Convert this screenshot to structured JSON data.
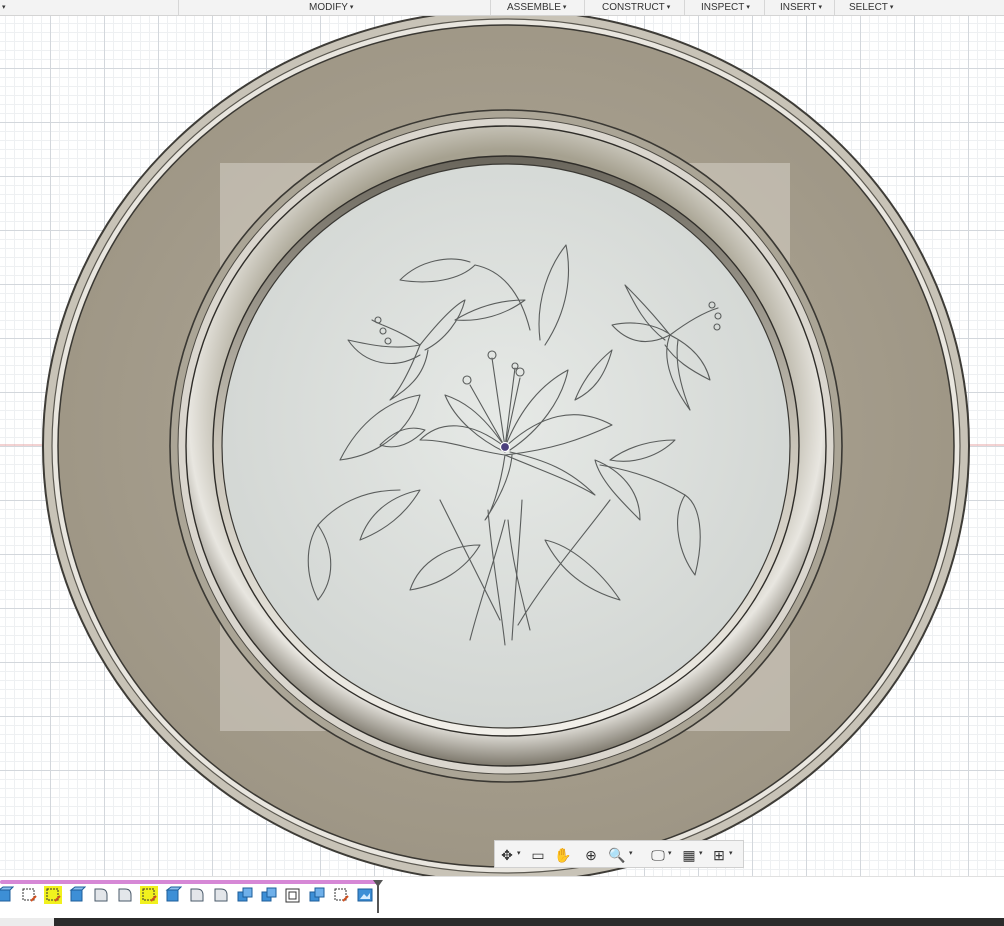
{
  "menubar": {
    "items": [
      {
        "label": "MODIFY"
      },
      {
        "label": "ASSEMBLE"
      },
      {
        "label": "CONSTRUCT"
      },
      {
        "label": "INSPECT"
      },
      {
        "label": "INSERT"
      },
      {
        "label": "SELECT"
      }
    ]
  },
  "navbar": {
    "tools": [
      {
        "icon": "orbit-icon",
        "glyph": "✥"
      },
      {
        "icon": "look-at-icon",
        "glyph": "▭"
      },
      {
        "icon": "pan-icon",
        "glyph": "✋"
      },
      {
        "icon": "zoom-icon",
        "glyph": "⊕"
      },
      {
        "icon": "fit-icon",
        "glyph": "🔍"
      },
      {
        "icon": "display-settings-icon",
        "glyph": "🖵"
      },
      {
        "icon": "grid-settings-icon",
        "glyph": "▦"
      },
      {
        "icon": "viewports-icon",
        "glyph": "⊞"
      }
    ]
  },
  "timeline": {
    "features": [
      {
        "icon": "extrude-feature-icon"
      },
      {
        "icon": "sketch-feature-icon"
      },
      {
        "icon": "sketch-feature-icon",
        "highlighted": true
      },
      {
        "icon": "extrude-feature-icon"
      },
      {
        "icon": "fillet-feature-icon"
      },
      {
        "icon": "fillet-feature-icon"
      },
      {
        "icon": "sketch-feature-icon",
        "highlighted": true
      },
      {
        "icon": "extrude-feature-icon"
      },
      {
        "icon": "fillet-feature-icon"
      },
      {
        "icon": "fillet-feature-icon"
      },
      {
        "icon": "combine-feature-icon"
      },
      {
        "icon": "combine-feature-icon"
      },
      {
        "icon": "shell-feature-icon"
      },
      {
        "icon": "combine-feature-icon"
      },
      {
        "icon": "sketch-feature-icon"
      },
      {
        "icon": "canvas-feature-icon"
      }
    ]
  },
  "colors": {
    "plate_rim": "#a69e8e",
    "plate_center": "#dde1de",
    "highlight": "#f1f11e",
    "timeline_bar": "#d688d6"
  }
}
